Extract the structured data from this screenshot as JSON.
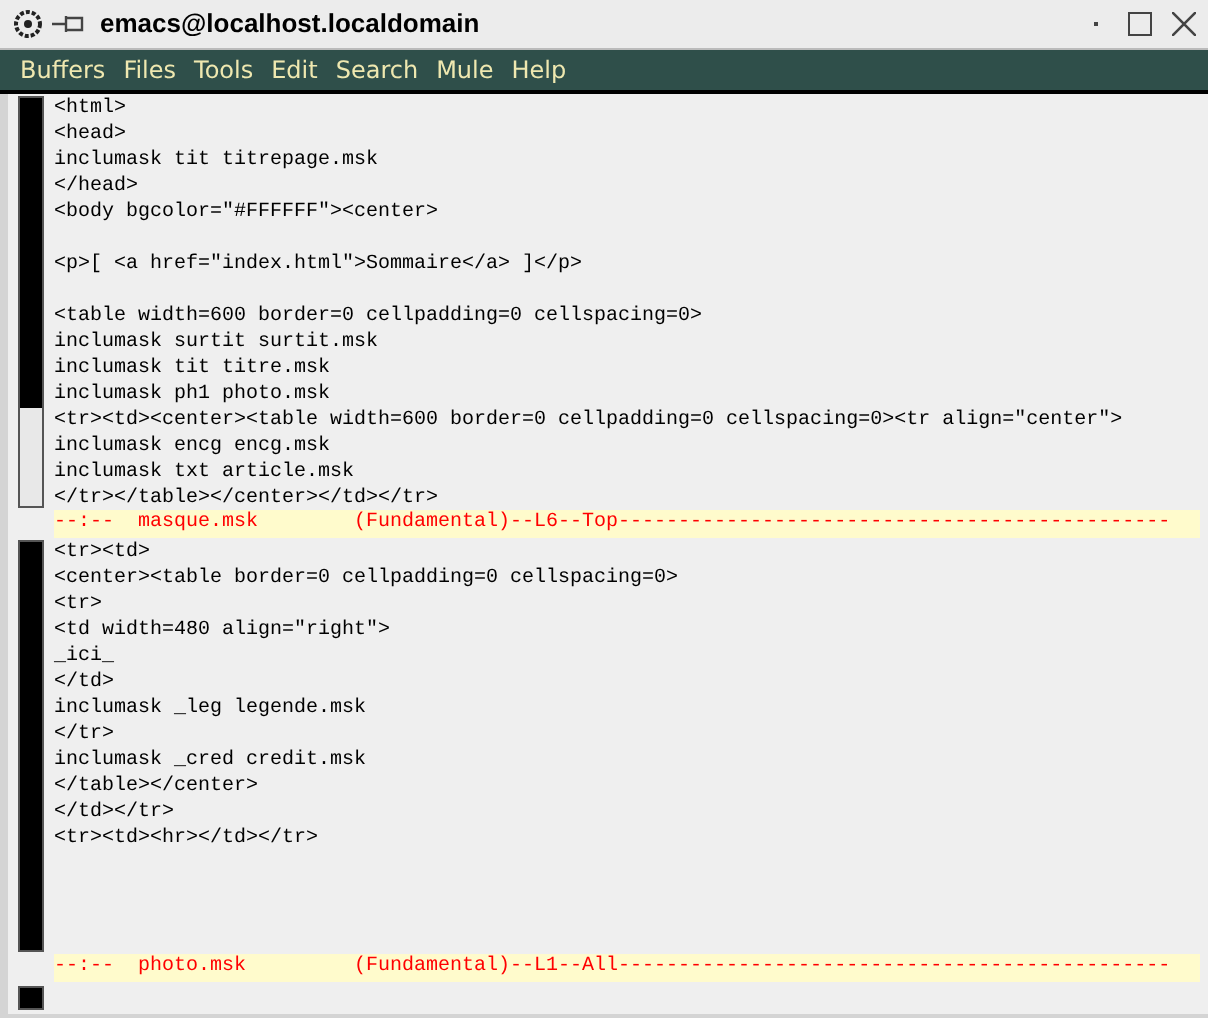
{
  "window": {
    "title": "emacs@localhost.localdomain"
  },
  "menu_bar": [
    "Buffers",
    "Files",
    "Tools",
    "Edit",
    "Search",
    "Mule",
    "Help"
  ],
  "panes": [
    {
      "blocks": [
        [
          "<html>",
          "<head>",
          "inclumask tit titrepage.msk",
          "</head>",
          "<body bgcolor=\"#FFFFFF\"><center>"
        ],
        [
          "<p>[ <a href=\"index.html\">Sommaire</a> ]</p>"
        ],
        [
          "<table width=600 border=0 cellpadding=0 cellspacing=0>",
          "inclumask surtit surtit.msk",
          "inclumask tit titre.msk",
          "inclumask ph1 photo.msk",
          "<tr><td><center><table width=600 border=0 cellpadding=0 cellspacing=0><tr align=\"center\">",
          "inclumask encg encg.msk",
          "inclumask txt article.msk",
          "</tr></table></center></td></tr>"
        ]
      ],
      "mode_line": "--:--  masque.msk        (Fundamental)--L6--Top----------------------------------------------"
    },
    {
      "blocks": [
        [
          "<tr><td>",
          "<center><table border=0 cellpadding=0 cellspacing=0>",
          "<tr>",
          "<td width=480 align=\"right\">",
          "_ici_",
          "</td>",
          "inclumask _leg legende.msk",
          "</tr>",
          "inclumask _cred credit.msk",
          "</table></center>",
          "</td></tr>",
          "<tr><td><hr></td></tr>"
        ]
      ],
      "mode_line": "--:--  photo.msk         (Fundamental)--L1--All----------------------------------------------"
    }
  ]
}
